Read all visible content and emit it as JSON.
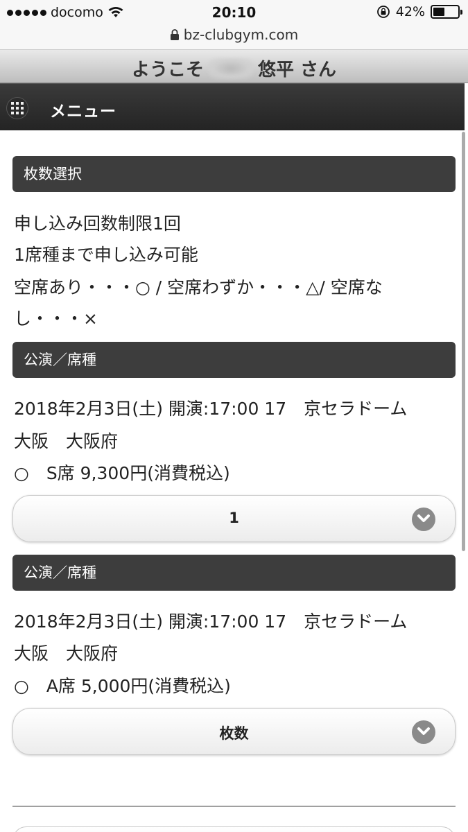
{
  "status": {
    "carrier": "docomo",
    "time": "20:10",
    "battery": "42%"
  },
  "url": "bz-clubgym.com",
  "welcome": {
    "prefix": "ようこそ",
    "name_suffix": "悠平 さん"
  },
  "menu": {
    "label": "メニュー"
  },
  "ticket_section": {
    "header": "枚数選択",
    "lines": [
      "申し込み回数制限1回",
      "1席種まで申し込み可能",
      "空席あり・・・○ / 空席わずか・・・△/ 空席な",
      "し・・・×"
    ]
  },
  "performances": [
    {
      "header": "公演／席種",
      "line1": "2018年2月3日(土) 開演:17:00 17　京セラドーム",
      "line2": "大阪　大阪府",
      "seat": "○　S席 9,300円(消費税込)",
      "select_value": "1"
    },
    {
      "header": "公演／席種",
      "line1": "2018年2月3日(土) 開演:17:00 17　京セラドーム",
      "line2": "大阪　大阪府",
      "seat": "○　A席 5,000円(消費税込)",
      "select_value": "枚数"
    }
  ]
}
